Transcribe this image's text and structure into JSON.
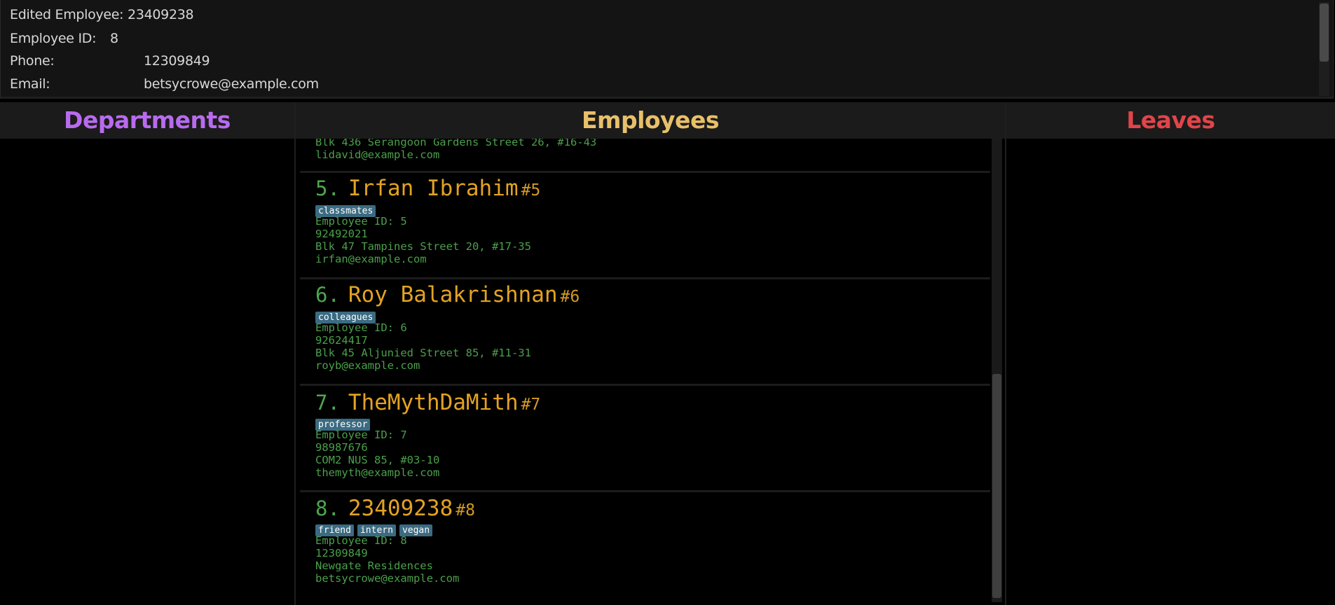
{
  "result": {
    "line1": "Edited Employee: 23409238",
    "id_label": "Employee ID:",
    "id_value": "8",
    "phone_label": "Phone:",
    "phone_value": "12309849",
    "email_label": "Email:",
    "email_value": "betsycrowe@example.com"
  },
  "headers": {
    "departments": "Departments",
    "employees": "Employees",
    "leaves": "Leaves"
  },
  "colors": {
    "departments": "#b86bee",
    "employees": "#e8c06a",
    "leaves": "#e0454a"
  },
  "partial_card": {
    "address": "Blk 436 Serangoon Gardens Street 26, #16-43",
    "email": "lidavid@example.com"
  },
  "employees": [
    {
      "index": "5.",
      "name": "Irfan Ibrahim",
      "id_tag": "#5",
      "tags": [
        "classmates"
      ],
      "employee_id": "Employee ID: 5",
      "phone": "92492021",
      "address": "Blk 47 Tampines Street 20, #17-35",
      "email": "irfan@example.com"
    },
    {
      "index": "6.",
      "name": "Roy Balakrishnan",
      "id_tag": "#6",
      "tags": [
        "colleagues"
      ],
      "employee_id": "Employee ID: 6",
      "phone": "92624417",
      "address": "Blk 45 Aljunied Street 85, #11-31",
      "email": "royb@example.com"
    },
    {
      "index": "7.",
      "name": "TheMythDaMith",
      "id_tag": "#7",
      "tags": [
        "professor"
      ],
      "employee_id": "Employee ID: 7",
      "phone": "98987676",
      "address": "COM2 NUS 85, #03-10",
      "email": "themyth@example.com"
    },
    {
      "index": "8.",
      "name": "23409238",
      "id_tag": "#8",
      "tags": [
        "friend",
        "intern",
        "vegan"
      ],
      "employee_id": "Employee ID: 8",
      "phone": "12309849",
      "address": "Newgate Residences",
      "email": "betsycrowe@example.com"
    }
  ]
}
